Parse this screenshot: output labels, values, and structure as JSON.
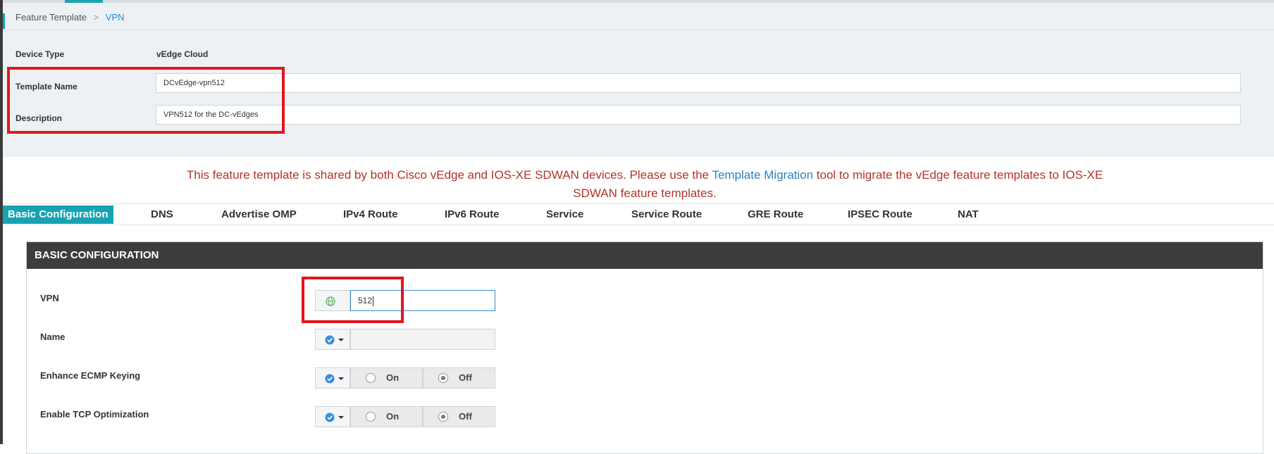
{
  "breadcrumb": {
    "parent": "Feature Template",
    "separator": ">",
    "current": "VPN"
  },
  "device": {
    "type_label": "Device Type",
    "type_value": "vEdge Cloud"
  },
  "template": {
    "name_label": "Template Name",
    "name_value": "DCvEdge-vpn512",
    "description_label": "Description",
    "description_value": "VPN512 for the DC-vEdges"
  },
  "warning": {
    "before": "This feature template is shared by both Cisco vEdge and IOS-XE SDWAN devices. Please use the ",
    "link": "Template Migration",
    "after": " tool to migrate the vEdge feature templates to IOS-XE SDWAN feature templates."
  },
  "tabs": [
    {
      "label": "Basic Configuration",
      "active": true
    },
    {
      "label": "DNS"
    },
    {
      "label": "Advertise OMP"
    },
    {
      "label": "IPv4 Route"
    },
    {
      "label": "IPv6 Route"
    },
    {
      "label": "Service"
    },
    {
      "label": "Service Route"
    },
    {
      "label": "GRE Route"
    },
    {
      "label": "IPSEC Route"
    },
    {
      "label": "NAT"
    }
  ],
  "basic_config": {
    "title": "BASIC CONFIGURATION",
    "vpn": {
      "label": "VPN",
      "value": "512",
      "scope_icon": "globe-icon"
    },
    "name": {
      "label": "Name",
      "value": "",
      "scope_icon": "check-circle-icon"
    },
    "ecmp": {
      "label": "Enhance ECMP Keying",
      "on": "On",
      "off": "Off",
      "selected": "Off",
      "scope_icon": "check-circle-icon"
    },
    "tcp": {
      "label": "Enable TCP Optimization",
      "on": "On",
      "off": "Off",
      "selected": "Off",
      "scope_icon": "check-circle-icon"
    }
  },
  "colors": {
    "accent": "#17a3b1",
    "highlight": "#e3151e",
    "warning_text": "#b3332b",
    "link": "#2a7fc4"
  }
}
